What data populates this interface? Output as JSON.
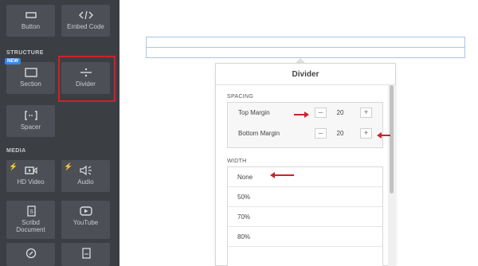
{
  "sidebar": {
    "top_tiles": [
      {
        "label": "Button",
        "icon": "button-icon"
      },
      {
        "label": "Embed Code",
        "icon": "code-icon"
      }
    ],
    "structure_label": "STRUCTURE",
    "new_badge": "NEW",
    "structure_tiles": [
      {
        "label": "Section",
        "icon": "section-icon"
      },
      {
        "label": "Divider",
        "icon": "divider-icon"
      },
      {
        "label": "Spacer",
        "icon": "spacer-icon"
      }
    ],
    "media_label": "MEDIA",
    "media_tiles": [
      {
        "label": "HD Video",
        "icon": "video-icon"
      },
      {
        "label": "Audio",
        "icon": "audio-icon"
      },
      {
        "label": "Scribd Document",
        "icon": "document-icon"
      },
      {
        "label": "YouTube",
        "icon": "youtube-icon"
      }
    ]
  },
  "panel": {
    "title": "Divider",
    "spacing": {
      "label": "SPACING",
      "top_margin": {
        "label": "Top Margin",
        "value": "20",
        "minus": "–",
        "plus": "+"
      },
      "bottom_margin": {
        "label": "Bottom Margin",
        "value": "20",
        "minus": "–",
        "plus": "+"
      }
    },
    "width": {
      "label": "WIDTH",
      "options": [
        "None",
        "50%",
        "70%",
        "80%"
      ]
    }
  },
  "colors": {
    "sidebar_bg": "#3b3f44",
    "tile_bg": "#4c5056",
    "highlight": "#d0202a",
    "badge": "#2f8be8",
    "bolt": "#f5a623"
  }
}
